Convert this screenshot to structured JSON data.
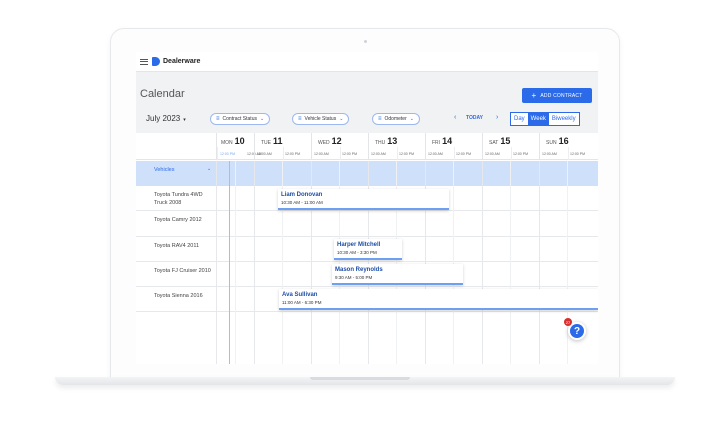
{
  "app": {
    "brand": "Dealerware"
  },
  "page": {
    "title": "Calendar",
    "add_button": "ADD CONTRACT",
    "add_icon": "+"
  },
  "toolbar": {
    "month": "July 2023",
    "month_caret": "▾",
    "filters": [
      {
        "label": "Contract Status"
      },
      {
        "label": "Vehicle Status"
      },
      {
        "label": "Odometer"
      }
    ],
    "prev_arrow": "‹",
    "today": "TODAY",
    "next_arrow": "›",
    "views": [
      {
        "label": "Day",
        "active": false
      },
      {
        "label": "Week",
        "active": true
      },
      {
        "label": "Biweekly",
        "active": false
      }
    ]
  },
  "days": [
    {
      "dow": "MON",
      "date": "10",
      "times": [
        "12:00 PM",
        "12:00 AM"
      ]
    },
    {
      "dow": "TUE",
      "date": "11",
      "times": [
        "12:00 AM",
        "12:00 PM"
      ]
    },
    {
      "dow": "WED",
      "date": "12",
      "times": [
        "12:00 AM",
        "12:00 PM"
      ]
    },
    {
      "dow": "THU",
      "date": "13",
      "times": [
        "12:00 AM",
        "12:00 PM"
      ]
    },
    {
      "dow": "FRI",
      "date": "14",
      "times": [
        "12:00 AM",
        "12:00 PM"
      ]
    },
    {
      "dow": "SAT",
      "date": "15",
      "times": [
        "12:00 AM",
        "12:00 PM"
      ]
    },
    {
      "dow": "SUN",
      "date": "16",
      "times": [
        "12:00 AM",
        "12:00 PM"
      ]
    }
  ],
  "vehicles": {
    "header": "Vehicles",
    "rows": [
      {
        "name": "Toyota Tundra 4WD Truck 2008"
      },
      {
        "name": "Toyota Camry 2012"
      },
      {
        "name": "Toyota RAV4 2011"
      },
      {
        "name": "Toyota FJ Cruiser 2010"
      },
      {
        "name": "Toyota Sienna 2016"
      }
    ]
  },
  "events": [
    {
      "name": "Liam Donovan",
      "time": "10:30 AM - 11:00 AM"
    },
    {
      "name": "Harper Mitchell",
      "time": "10:30 AM - 3:30 PM"
    },
    {
      "name": "Mason Reynolds",
      "time": "9:30 AM - 5:00 PM"
    },
    {
      "name": "Ava Sullivan",
      "time": "11:00 AM - 6:30 PM"
    }
  ],
  "help": {
    "icon": "?",
    "badge": "27"
  },
  "colors": {
    "accent": "#2b6ae8",
    "band": "#cfe0fb",
    "badge": "#d62f2f"
  }
}
